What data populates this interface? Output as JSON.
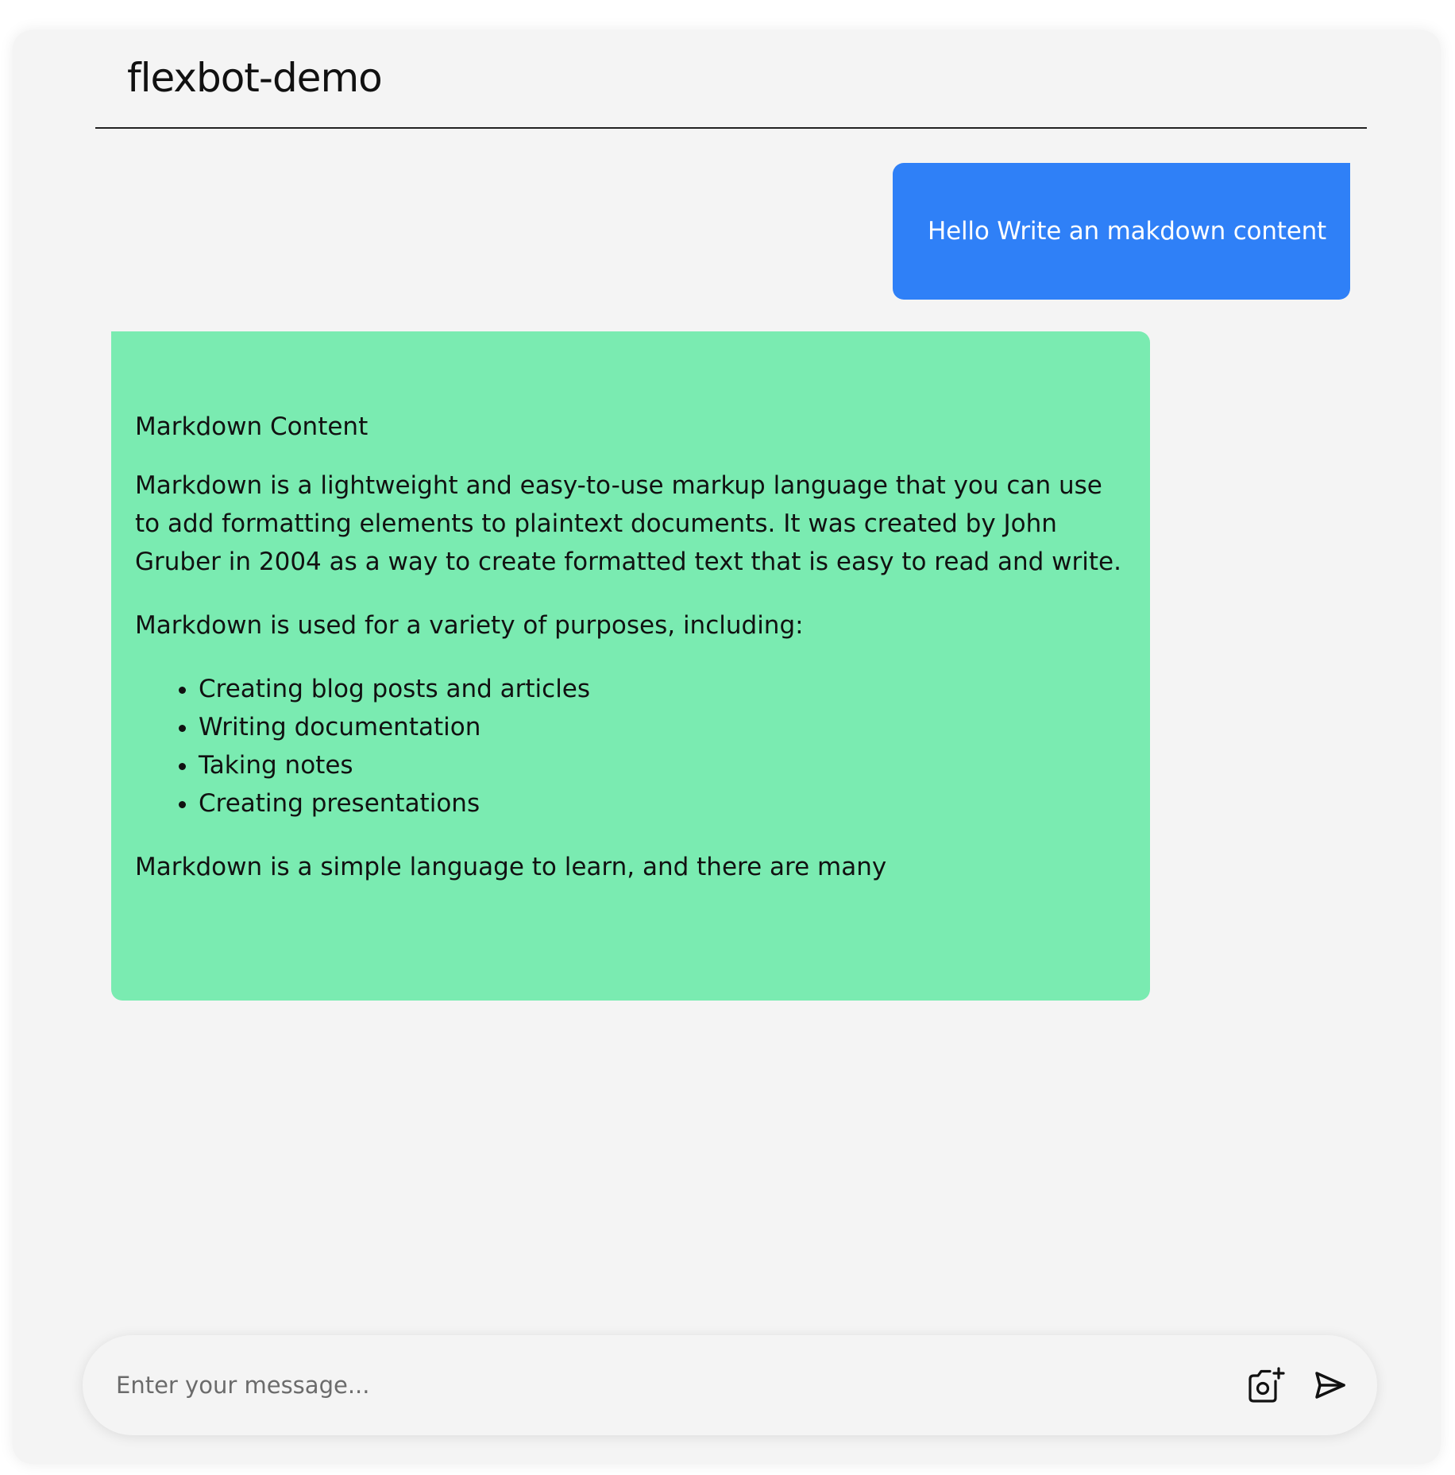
{
  "app": {
    "title": "flexbot-demo"
  },
  "messages": {
    "user": {
      "text": "Hello Write an makdown content",
      "color": "#2f80f7"
    },
    "bot": {
      "color": "#7aebb1",
      "heading": "Markdown Content",
      "paragraph1": "Markdown is a lightweight and easy-to-use markup language that you can use to add formatting elements to plaintext documents. It was created by John Gruber in 2004 as a way to create formatted text that is easy to read and write.",
      "paragraph2": "Markdown is used for a variety of purposes, including:",
      "list": [
        "Creating blog posts and articles",
        "Writing documentation",
        "Taking notes",
        "Creating presentations"
      ],
      "paragraph3": "Markdown is a simple language to learn, and there are many"
    }
  },
  "composer": {
    "placeholder": "Enter your message...",
    "value": "",
    "camera_icon": "camera-plus-icon",
    "send_icon": "send-icon"
  }
}
